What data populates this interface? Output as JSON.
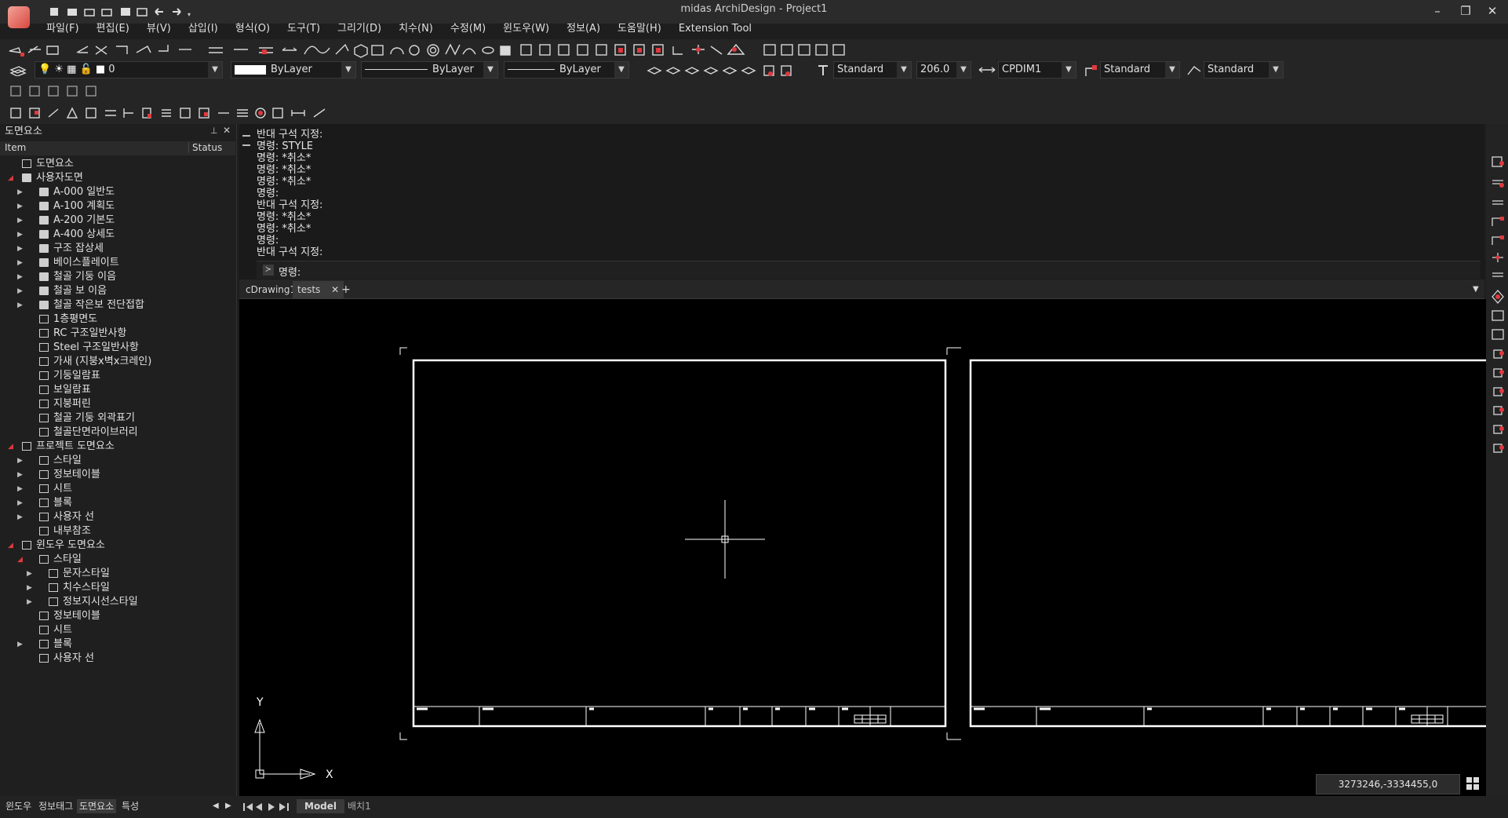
{
  "app": {
    "title": "midas ArchiDesign - Project1"
  },
  "window_controls": {
    "minimize": "–",
    "restore": "❐",
    "close": "✕"
  },
  "menu": [
    "파일(F)",
    "편집(E)",
    "뷰(V)",
    "삽입(I)",
    "형식(O)",
    "도구(T)",
    "그리기(D)",
    "치수(N)",
    "수정(M)",
    "윈도우(W)",
    "정보(A)",
    "도움말(H)",
    "Extension Tool"
  ],
  "toolbar": {
    "layer_value": "0",
    "color_value": "ByLayer",
    "linetype_value": "ByLayer",
    "lineweight_value": "ByLayer",
    "text_style": "Standard",
    "text_height": "206.0",
    "dim_style": "CPDIM1",
    "leader_style": "Standard",
    "table_style": "Standard"
  },
  "left_panel": {
    "title": "도면요소",
    "pin": "📌",
    "close": "✕",
    "col_item": "Item",
    "col_status": "Status",
    "rows": [
      {
        "label": "도면요소",
        "level": 0,
        "tw": "",
        "icon": "drawing-element-icon"
      },
      {
        "label": "사용자도면",
        "level": 0,
        "tw": "◢",
        "icon": "folder-icon"
      },
      {
        "label": "A-000 일반도",
        "level": 1,
        "tw": "▶",
        "icon": "folder-icon"
      },
      {
        "label": "A-100 계획도",
        "level": 1,
        "tw": "▶",
        "icon": "folder-icon"
      },
      {
        "label": "A-200 기본도",
        "level": 1,
        "tw": "▶",
        "icon": "folder-icon"
      },
      {
        "label": "A-400 상세도",
        "level": 1,
        "tw": "▶",
        "icon": "folder-icon"
      },
      {
        "label": "구조 잡상세",
        "level": 1,
        "tw": "▶",
        "icon": "folder-icon"
      },
      {
        "label": "베이스플레이트",
        "level": 1,
        "tw": "▶",
        "icon": "folder-icon"
      },
      {
        "label": "철골 기둥 이음",
        "level": 1,
        "tw": "▶",
        "icon": "folder-icon"
      },
      {
        "label": "철골 보 이음",
        "level": 1,
        "tw": "▶",
        "icon": "folder-icon"
      },
      {
        "label": "철골 작은보 전단접합",
        "level": 1,
        "tw": "▶",
        "icon": "folder-icon"
      },
      {
        "label": "1층평면도",
        "level": 1,
        "tw": "",
        "icon": "sheet-icon"
      },
      {
        "label": "RC 구조일반사항",
        "level": 1,
        "tw": "",
        "icon": "sheet-icon"
      },
      {
        "label": "Steel 구조일반사항",
        "level": 1,
        "tw": "",
        "icon": "sheet-icon"
      },
      {
        "label": "가새 (지붕x벽x크레인)",
        "level": 1,
        "tw": "",
        "icon": "sheet-icon"
      },
      {
        "label": "기둥일람표",
        "level": 1,
        "tw": "",
        "icon": "sheet-icon"
      },
      {
        "label": "보일람표",
        "level": 1,
        "tw": "",
        "icon": "sheet-icon"
      },
      {
        "label": "지붕퍼린",
        "level": 1,
        "tw": "",
        "icon": "sheet-icon"
      },
      {
        "label": "철골 기둥 외곽표기",
        "level": 1,
        "tw": "",
        "icon": "sheet-icon"
      },
      {
        "label": "철골단면라이브러리",
        "level": 1,
        "tw": "",
        "icon": "sheet-icon"
      },
      {
        "label": "프로젝트 도면요소",
        "level": 0,
        "tw": "◢",
        "icon": "project-icon"
      },
      {
        "label": "스타일",
        "level": 1,
        "tw": "▶",
        "icon": "style-icon"
      },
      {
        "label": "정보테이블",
        "level": 1,
        "tw": "▶",
        "icon": "table-icon"
      },
      {
        "label": "시트",
        "level": 1,
        "tw": "▶",
        "icon": "sheet-icon"
      },
      {
        "label": "블록",
        "level": 1,
        "tw": "▶",
        "icon": "block-icon"
      },
      {
        "label": "사용자 선",
        "level": 1,
        "tw": "▶",
        "icon": "line-icon"
      },
      {
        "label": "내부참조",
        "level": 1,
        "tw": "",
        "icon": "xref-icon"
      },
      {
        "label": "윈도우 도면요소",
        "level": 0,
        "tw": "◢",
        "icon": "window-icon"
      },
      {
        "label": "스타일",
        "level": 1,
        "tw": "◢",
        "icon": "style-icon"
      },
      {
        "label": "문자스타일",
        "level": 2,
        "tw": "▶",
        "icon": "text-style-icon"
      },
      {
        "label": "치수스타일",
        "level": 2,
        "tw": "▶",
        "icon": "dim-style-icon"
      },
      {
        "label": "정보지시선스타일",
        "level": 2,
        "tw": "▶",
        "icon": "leader-style-icon"
      },
      {
        "label": "정보테이블",
        "level": 1,
        "tw": "",
        "icon": "table-icon"
      },
      {
        "label": "시트",
        "level": 1,
        "tw": "",
        "icon": "sheet-icon"
      },
      {
        "label": "블록",
        "level": 1,
        "tw": "▶",
        "icon": "block-icon"
      },
      {
        "label": "사용자 선",
        "level": 1,
        "tw": "",
        "icon": "line-icon"
      }
    ]
  },
  "command": {
    "history": [
      "반대 구석 지정:",
      "명령: STYLE",
      "명령: *취소*",
      "명령: *취소*",
      "명령: *취소*",
      "명령:",
      "반대 구석 지정:",
      "명령: *취소*",
      "명령: *취소*",
      "명령:",
      "반대 구석 지정:"
    ],
    "prompt": "명령:"
  },
  "doc_tabs": {
    "tab1": "cDrawing1",
    "tab2": "tests",
    "close": "✕",
    "add": "+",
    "menu": "▼"
  },
  "canvas": {
    "ucs_x": "X",
    "ucs_y": "Y",
    "coords": "3273246,-3334455,0"
  },
  "bottom_tabs": [
    "윈도우",
    "정보태그",
    "도면요소",
    "특성"
  ],
  "layout_tabs": {
    "model": "Model",
    "layout": "배치1"
  }
}
